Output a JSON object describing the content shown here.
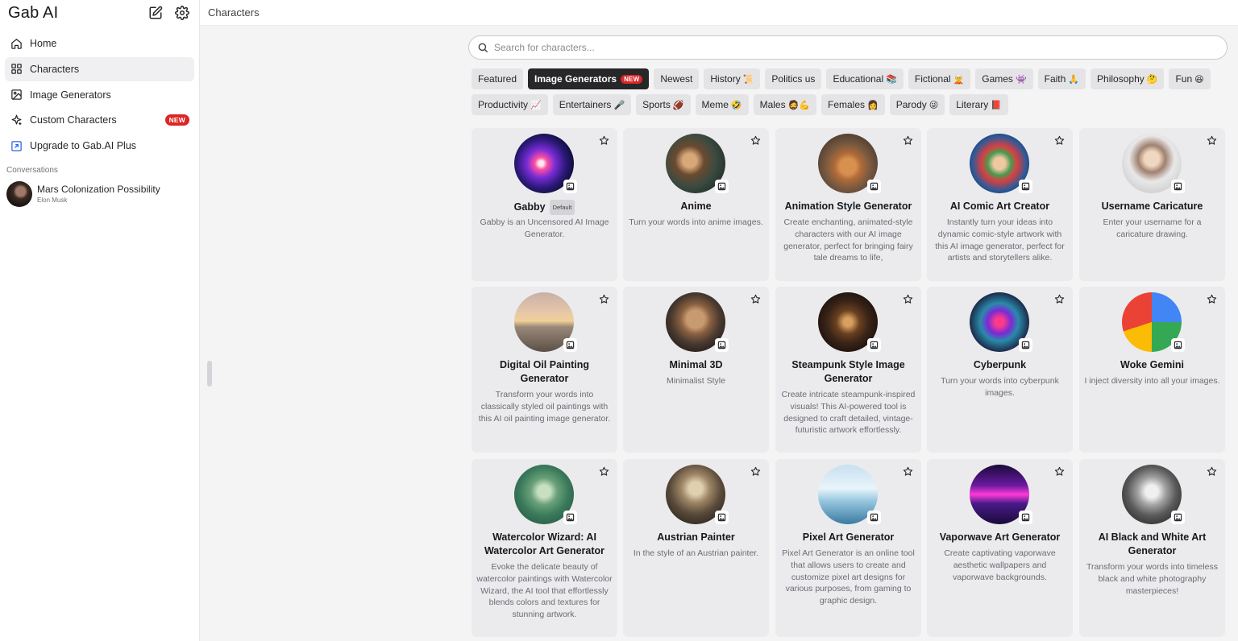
{
  "sidebar": {
    "brand": "Gab AI",
    "nav": [
      {
        "label": "Home",
        "icon": "home-icon"
      },
      {
        "label": "Characters",
        "icon": "grid-icon",
        "active": true
      },
      {
        "label": "Image Generators",
        "icon": "image-icon"
      },
      {
        "label": "Custom Characters",
        "icon": "sparkle-icon",
        "badge": "NEW"
      },
      {
        "label": "Upgrade to Gab.AI Plus",
        "icon": "upgrade-icon"
      }
    ],
    "conversations_label": "Conversations",
    "conversations": [
      {
        "title": "Mars Colonization Possibility",
        "subtitle": "Elon Musk"
      }
    ]
  },
  "topbar": {
    "title": "Characters"
  },
  "search": {
    "placeholder": "Search for characters..."
  },
  "tags": {
    "row1": [
      {
        "label": "Featured"
      },
      {
        "label": "Image Generators",
        "active": true,
        "badge": "NEW"
      },
      {
        "label": "Newest"
      },
      {
        "label": "History",
        "emoji": "📜"
      },
      {
        "label": "Politics us"
      },
      {
        "label": "Educational",
        "emoji": "📚"
      },
      {
        "label": "Fictional",
        "emoji": "🧝"
      },
      {
        "label": "Games",
        "emoji": "👾"
      },
      {
        "label": "Faith",
        "emoji": "🙏"
      },
      {
        "label": "Philosophy",
        "emoji": "🤔"
      },
      {
        "label": "Fun",
        "emoji": "😆"
      }
    ],
    "row2": [
      {
        "label": "Productivity",
        "emoji": "📈"
      },
      {
        "label": "Entertainers",
        "emoji": "🎤"
      },
      {
        "label": "Sports",
        "emoji": "🏈"
      },
      {
        "label": "Meme",
        "emoji": "🤣"
      },
      {
        "label": "Males",
        "emoji": "🧔💪"
      },
      {
        "label": "Females",
        "emoji": "👩"
      },
      {
        "label": "Parody",
        "emoji": "😜"
      },
      {
        "label": "Literary",
        "emoji": "📕"
      }
    ]
  },
  "cards": [
    {
      "name": "Gabby",
      "badge": "Default",
      "desc": "Gabby is an Uncensored AI Image Generator.",
      "theme": "galaxy"
    },
    {
      "name": "Anime",
      "desc": "Turn your words into anime images.",
      "theme": "anime"
    },
    {
      "name": "Animation Style Generator",
      "desc": "Create enchanting, animated-style characters with our AI image generator, perfect for bringing fairy tale dreams to life,",
      "theme": "puppies"
    },
    {
      "name": "AI Comic Art Creator",
      "desc": "Instantly turn your ideas into dynamic comic-style artwork with this AI image generator, perfect for artists and storytellers alike.",
      "theme": "comic"
    },
    {
      "name": "Username Caricature",
      "desc": "Enter your username for a caricature drawing.",
      "theme": "caricature"
    },
    {
      "name": "Digital Oil Painting Generator",
      "desc": "Transform your words into classically styled oil paintings with this AI oil painting image generator.",
      "theme": "sunset"
    },
    {
      "name": "Minimal 3D",
      "desc": "Minimalist Style",
      "theme": "dog"
    },
    {
      "name": "Steampunk Style Image Generator",
      "desc": "Create intricate steampunk-inspired visuals! This AI-powered tool is designed to craft detailed, vintage-futuristic artwork effortlessly.",
      "theme": "steampunk"
    },
    {
      "name": "Cyberpunk",
      "desc": "Turn your words into cyberpunk images.",
      "theme": "cyberpunk"
    },
    {
      "name": "Woke Gemini",
      "desc": "I inject diversity into all your images.",
      "theme": "gemini"
    },
    {
      "name": "Watercolor Wizard: AI Watercolor Art Generator",
      "desc": "Evoke the delicate beauty of watercolor paintings with Watercolor Wizard, the AI tool that effortlessly blends colors and textures for stunning artwork.",
      "theme": "watercolor"
    },
    {
      "name": "Austrian Painter",
      "desc": "In the style of an Austrian painter.",
      "theme": "castle"
    },
    {
      "name": "Pixel Art Generator",
      "desc": "Pixel Art Generator is an online tool that allows users to create and customize pixel art designs for various purposes, from gaming to graphic design.",
      "theme": "pixel"
    },
    {
      "name": "Vaporwave Art Generator",
      "desc": "Create captivating vaporwave aesthetic wallpapers and vaporwave backgrounds.",
      "theme": "vaporwave"
    },
    {
      "name": "AI Black and White Art Generator",
      "desc": "Transform your words into timeless black and white photography masterpieces!",
      "theme": "bw"
    }
  ],
  "colors": {
    "accent_badge": "#dc2626",
    "active_tag": "#27272a",
    "card_bg": "#ebebed"
  }
}
